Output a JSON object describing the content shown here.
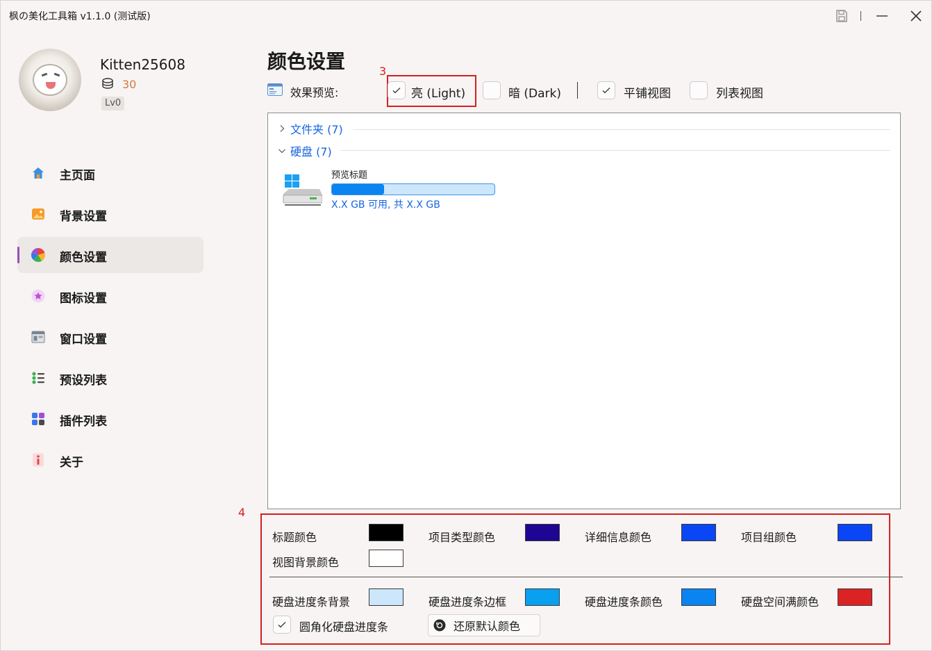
{
  "app": {
    "title": "枫の美化工具箱 v1.1.0 (测试版)"
  },
  "user": {
    "name": "Kitten25608",
    "coins": "30",
    "level": "Lv0"
  },
  "nav": {
    "items": [
      {
        "label": "主页面",
        "icon": "home-icon"
      },
      {
        "label": "背景设置",
        "icon": "image-icon"
      },
      {
        "label": "颜色设置",
        "icon": "palette-icon",
        "active": true
      },
      {
        "label": "图标设置",
        "icon": "star-icon"
      },
      {
        "label": "窗口设置",
        "icon": "window-icon"
      },
      {
        "label": "预设列表",
        "icon": "list-icon"
      },
      {
        "label": "插件列表",
        "icon": "grid-icon"
      },
      {
        "label": "关于",
        "icon": "info-icon"
      }
    ]
  },
  "page": {
    "title": "颜色设置",
    "annotations": {
      "a3": "3",
      "a4": "4"
    }
  },
  "preview": {
    "label": "效果预览:",
    "light": {
      "label": "亮 (Light)",
      "checked": true
    },
    "dark": {
      "label": "暗 (Dark)",
      "checked": false
    },
    "tile": {
      "label": "平铺视图",
      "checked": true
    },
    "list": {
      "label": "列表视图",
      "checked": false
    }
  },
  "explorer": {
    "groups": [
      {
        "label": "文件夹 (7)",
        "expanded": false
      },
      {
        "label": "硬盘 (7)",
        "expanded": true
      }
    ],
    "drive": {
      "name": "预览标题",
      "detail": "X.X GB 可用, 共 X.X GB",
      "used_fraction": 0.32
    }
  },
  "colors": {
    "title_color": {
      "label": "标题颜色",
      "value": "#000000"
    },
    "type_color": {
      "label": "项目类型颜色",
      "value": "#1e0594"
    },
    "detail_color": {
      "label": "详细信息颜色",
      "value": "#0a46f5"
    },
    "group_color": {
      "label": "项目组颜色",
      "value": "#0a46f5"
    },
    "view_bg_color": {
      "label": "视图背景颜色",
      "value": "#ffffff"
    },
    "bar_bg_color": {
      "label": "硬盘进度条背景",
      "value": "#cce6fb"
    },
    "bar_border_color": {
      "label": "硬盘进度条边框",
      "value": "#0aa0f0"
    },
    "bar_fill_color": {
      "label": "硬盘进度条颜色",
      "value": "#0a84f0"
    },
    "bar_full_color": {
      "label": "硬盘空间满颜色",
      "value": "#dc2323"
    },
    "rounded_bar": {
      "label": "圆角化硬盘进度条",
      "checked": true
    },
    "reset_label": "还原默认颜色"
  }
}
